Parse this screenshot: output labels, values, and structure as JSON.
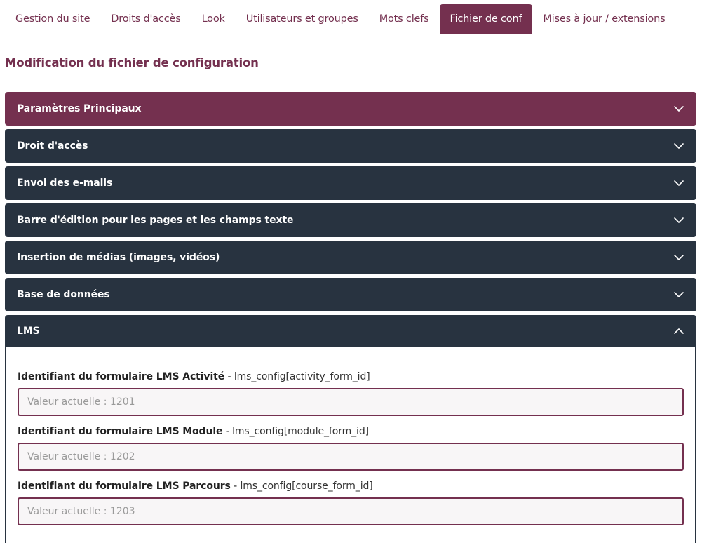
{
  "tabs": [
    {
      "label": "Gestion du site",
      "active": false
    },
    {
      "label": "Droits d'accès",
      "active": false
    },
    {
      "label": "Look",
      "active": false
    },
    {
      "label": "Utilisateurs et groupes",
      "active": false
    },
    {
      "label": "Mots clefs",
      "active": false
    },
    {
      "label": "Fichier de conf",
      "active": true
    },
    {
      "label": "Mises à jour / extensions",
      "active": false
    }
  ],
  "page": {
    "title": "Modification du fichier de configuration"
  },
  "sections": [
    {
      "title": "Paramètres Principaux",
      "expanded": false,
      "icon": "chevron-down-icon"
    },
    {
      "title": "Droit d'accès",
      "expanded": false,
      "icon": "chevron-down-icon"
    },
    {
      "title": "Envoi des e-mails",
      "expanded": false,
      "icon": "chevron-down-icon"
    },
    {
      "title": "Barre d'édition pour les pages et les champs texte",
      "expanded": false,
      "icon": "chevron-down-icon"
    },
    {
      "title": "Insertion de médias (images, vidéos)",
      "expanded": false,
      "icon": "chevron-down-icon"
    },
    {
      "title": "Base de données",
      "expanded": false,
      "icon": "chevron-down-icon"
    },
    {
      "title": "LMS",
      "expanded": true,
      "icon": "chevron-up-icon"
    }
  ],
  "lms": {
    "fields": [
      {
        "label": "Identifiant du formulaire LMS Activité",
        "separator": " - ",
        "key": "lms_config[activity_form_id]",
        "value": "",
        "placeholder": "Valeur actuelle : 1201"
      },
      {
        "label": "Identifiant du formulaire LMS Module",
        "separator": " - ",
        "key": "lms_config[module_form_id]",
        "value": "",
        "placeholder": "Valeur actuelle : 1202"
      },
      {
        "label": "Identifiant du formulaire LMS Parcours",
        "separator": " - ",
        "key": "lms_config[course_form_id]",
        "value": "",
        "placeholder": "Valeur actuelle : 1203"
      }
    ]
  },
  "colors": {
    "accent": "#74304f",
    "panel_dark": "#283340",
    "tab_border": "#dddddd",
    "input_bg": "#f8f6f7"
  }
}
